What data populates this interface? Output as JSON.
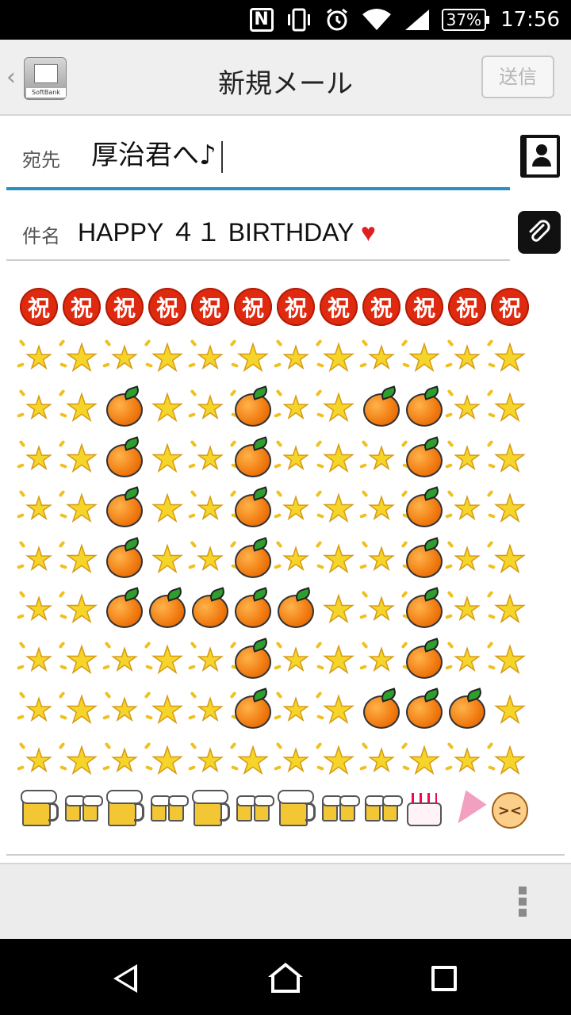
{
  "status_bar": {
    "nfc_label": "N",
    "vibrate_icon": "vibrate-icon",
    "alarm_icon": "alarm-icon",
    "wifi_icon": "wifi-icon",
    "signal_icon": "signal-icon",
    "battery": "37%",
    "time": "17:56"
  },
  "action_bar": {
    "back": "‹",
    "app_icon_brand": "SoftBank",
    "title": "新規メール",
    "send_label": "送信"
  },
  "compose": {
    "to_label": "宛先",
    "to_value": "厚治君へ♪",
    "subject_label": "件名",
    "subject_value": "HAPPY ４１ BIRTHDAY ",
    "subject_heart": "♥"
  },
  "body_rows": [
    [
      "iwai",
      "iwai",
      "iwai",
      "iwai",
      "iwai",
      "iwai",
      "iwai",
      "iwai",
      "iwai",
      "iwai",
      "iwai",
      "iwai"
    ],
    [
      "sparkle",
      "star",
      "sparkle",
      "star",
      "sparkle",
      "star",
      "sparkle",
      "star",
      "sparkle",
      "star",
      "sparkle",
      "star"
    ],
    [
      "sparkle",
      "star",
      "orange",
      "star",
      "sparkle",
      "orange",
      "sparkle",
      "star",
      "orange",
      "orange",
      "sparkle",
      "star"
    ],
    [
      "sparkle",
      "star",
      "orange",
      "star",
      "sparkle",
      "orange",
      "sparkle",
      "star",
      "sparkle",
      "orange",
      "sparkle",
      "star"
    ],
    [
      "sparkle",
      "star",
      "orange",
      "star",
      "sparkle",
      "orange",
      "sparkle",
      "star",
      "sparkle",
      "orange",
      "sparkle",
      "star"
    ],
    [
      "sparkle",
      "star",
      "orange",
      "star",
      "sparkle",
      "orange",
      "sparkle",
      "star",
      "sparkle",
      "orange",
      "sparkle",
      "star"
    ],
    [
      "sparkle",
      "star",
      "orange",
      "orange",
      "orange",
      "orange",
      "orange",
      "star",
      "sparkle",
      "orange",
      "sparkle",
      "star"
    ],
    [
      "sparkle",
      "star",
      "sparkle",
      "star",
      "sparkle",
      "orange",
      "sparkle",
      "star",
      "sparkle",
      "orange",
      "sparkle",
      "star"
    ],
    [
      "sparkle",
      "star",
      "sparkle",
      "star",
      "sparkle",
      "orange",
      "sparkle",
      "star",
      "orange",
      "orange",
      "orange",
      "star"
    ],
    [
      "sparkle",
      "star",
      "sparkle",
      "star",
      "sparkle",
      "star",
      "sparkle",
      "star",
      "sparkle",
      "star",
      "sparkle",
      "star"
    ],
    [
      "beer",
      "cheers",
      "beer",
      "cheers",
      "beer",
      "cheers",
      "beer",
      "cheers",
      "cheers",
      "cake",
      "popper",
      "face"
    ]
  ],
  "iwai_char": "祝",
  "star_char": "★",
  "face_char": "><",
  "toolbar": {
    "overflow_icon": "overflow-menu-icon"
  },
  "nav": {
    "back_icon": "back-icon",
    "home_icon": "home-icon",
    "recents_icon": "recents-icon"
  }
}
